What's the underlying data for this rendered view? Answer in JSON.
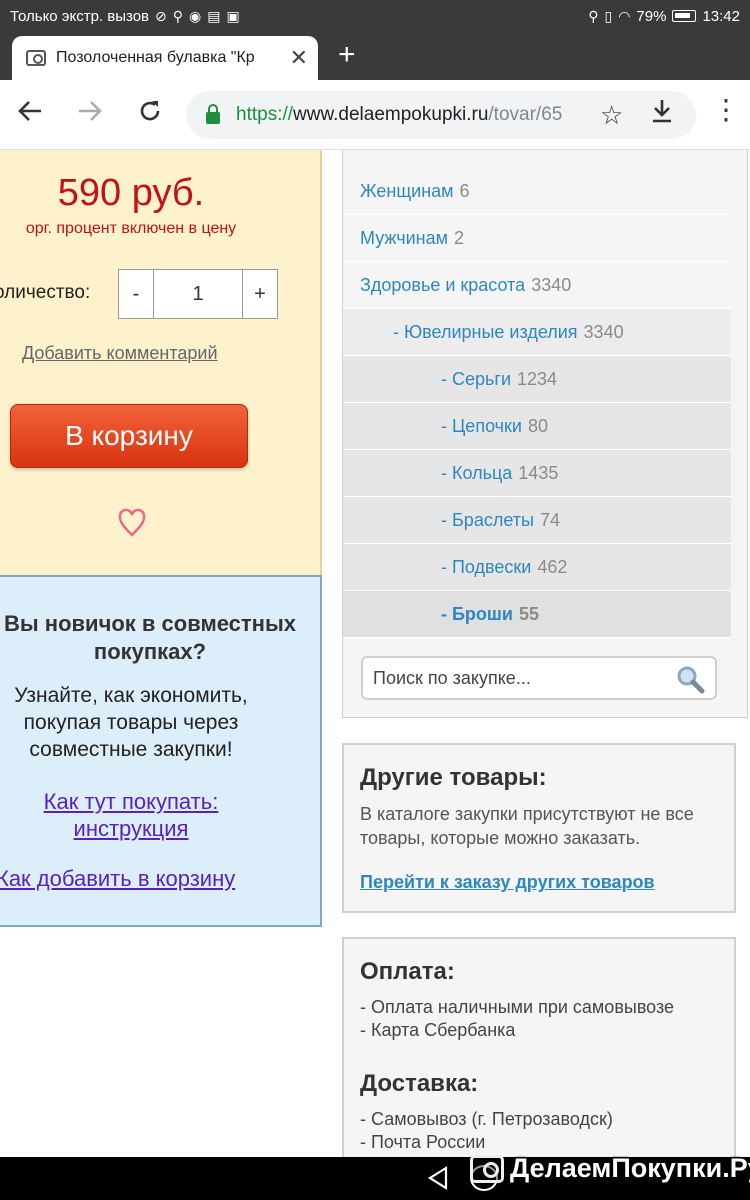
{
  "status_bar": {
    "carrier": "Только экстр. вызов",
    "battery": "79%",
    "time": "13:42"
  },
  "tab": {
    "title": "Позолоченная булавка \"Кр",
    "close": "✕",
    "new_tab": "+"
  },
  "address": {
    "scheme": "https://",
    "host": "www.delaempokupki.ru",
    "path": "/tovar/65"
  },
  "product": {
    "price": "590 руб.",
    "price_note": "орг. процент включен в цену",
    "qty_label": "оличество:",
    "qty_minus": "-",
    "qty_value": "1",
    "qty_plus": "+",
    "add_comment": "Добавить комментарий",
    "cart_button": "В корзину"
  },
  "info": {
    "title": "Вы новичок в совместных покупках?",
    "text": "Узнайте, как экономить, покупая товары через совместные закупки!",
    "link1": "Как тут покупать: инструкция",
    "link2": "Как добавить в корзину"
  },
  "categories": [
    {
      "name": "Женщинам",
      "count": "6",
      "level": 0,
      "active": false
    },
    {
      "name": "Мужчинам",
      "count": "2",
      "level": 0,
      "active": false
    },
    {
      "name": "Здоровье и красота",
      "count": "3340",
      "level": 0,
      "active": false
    },
    {
      "name": "- Ювелирные изделия",
      "count": "3340",
      "level": 1,
      "active": false
    },
    {
      "name": "- Серьги",
      "count": "1234",
      "level": 2,
      "active": false
    },
    {
      "name": "- Цепочки",
      "count": "80",
      "level": 2,
      "active": false
    },
    {
      "name": "- Кольца",
      "count": "1435",
      "level": 2,
      "active": false
    },
    {
      "name": "- Браслеты",
      "count": "74",
      "level": 2,
      "active": false
    },
    {
      "name": "- Подвески",
      "count": "462",
      "level": 2,
      "active": false
    },
    {
      "name": "- Броши",
      "count": "55",
      "level": 2,
      "active": true
    }
  ],
  "search": {
    "placeholder": "Поиск по закупке..."
  },
  "other": {
    "title": "Другие товары:",
    "text": "В каталоге закупки присутствуют не все товары, которые можно заказать.",
    "link": "Перейти к заказу других товаров"
  },
  "payment": {
    "title": "Оплата:",
    "items": [
      "- Оплата наличными при самовывозе",
      "- Карта Сбербанка"
    ]
  },
  "delivery": {
    "title": "Доставка:",
    "items": [
      "- Самовывоз (г. Петрозаводск)",
      "- Почта России"
    ]
  },
  "watermark": {
    "text": "ДелаемПокупки.Ру"
  },
  "colors": {
    "link": "#2d87c2",
    "price": "#c41212",
    "cart_button": "#e2431d",
    "product_bg": "#fdf2cc",
    "info_bg": "#dbeefa"
  }
}
